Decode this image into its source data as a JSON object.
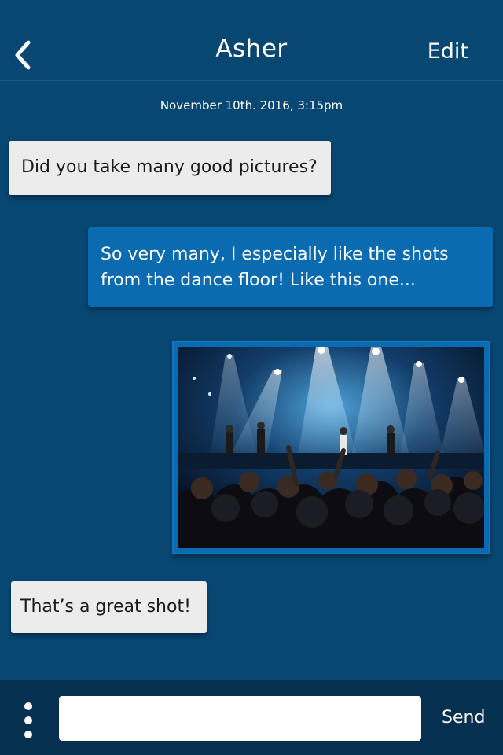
{
  "header": {
    "back_icon": "chevron-left-icon",
    "title": "Asher",
    "edit_label": "Edit"
  },
  "conversation": {
    "timestamp": "November 10th. 2016, 3:15pm",
    "messages": [
      {
        "direction": "incoming",
        "type": "text",
        "text": "Did you take many good pictures?"
      },
      {
        "direction": "outgoing",
        "type": "text",
        "text": "So very many, I especially like the shots from the dance floor! Like this one..."
      },
      {
        "direction": "outgoing",
        "type": "image",
        "subject": "concert crowd under stage lights"
      },
      {
        "direction": "incoming",
        "type": "text",
        "text": "That’s a great shot!"
      }
    ]
  },
  "composer": {
    "menu_icon": "more-vertical-icon",
    "input_value": "",
    "input_placeholder": "",
    "send_label": "Send"
  },
  "colors": {
    "background": "#094773",
    "outgoing_bubble": "#0b6bb1",
    "incoming_bubble": "#ececec",
    "composer_bar": "#06304f"
  }
}
